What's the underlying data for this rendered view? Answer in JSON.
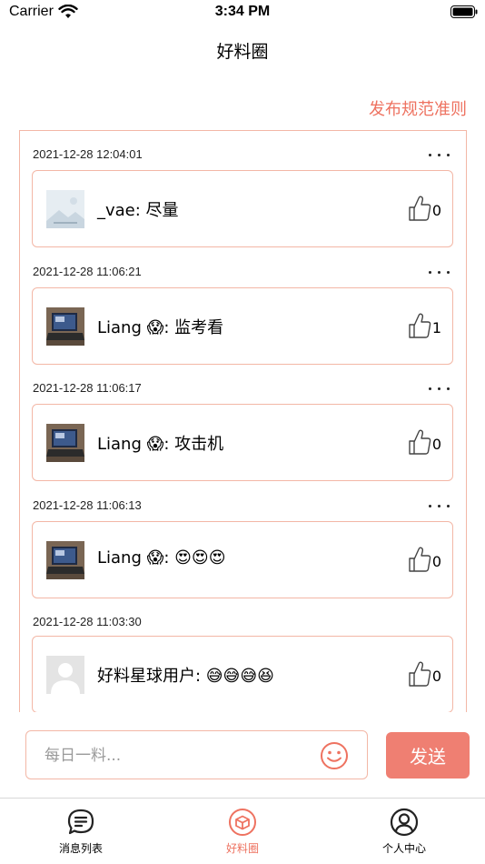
{
  "status_bar": {
    "carrier": "Carrier",
    "time": "3:34 PM"
  },
  "nav": {
    "title": "好料圈",
    "rules_link": "发布规范准则"
  },
  "colors": {
    "accent": "#ee7260",
    "border": "#f3b7a6",
    "send_button": "#ef7f72"
  },
  "posts": [
    {
      "time": "2021-12-28 12:04:01",
      "author": "_vae",
      "text": "_vae: 尽量",
      "likes": "0",
      "avatar": "placeholder-image",
      "has_more": true
    },
    {
      "time": "2021-12-28 11:06:21",
      "author": "Liang 😱",
      "text": "Liang 😱: 监考看",
      "likes": "1",
      "avatar": "laptop-photo",
      "has_more": true
    },
    {
      "time": "2021-12-28 11:06:17",
      "author": "Liang 😱",
      "text": "Liang 😱: 攻击机",
      "likes": "0",
      "avatar": "laptop-photo",
      "has_more": true
    },
    {
      "time": "2021-12-28 11:06:13",
      "author": "Liang 😱",
      "text": "Liang 😱: 😍😍😍",
      "likes": "0",
      "avatar": "laptop-photo",
      "has_more": true
    },
    {
      "time": "2021-12-28 11:03:30",
      "author": "好料星球用户",
      "text": "好料星球用户: 😅😅😅😆",
      "likes": "0",
      "avatar": "default-user",
      "has_more": false
    }
  ],
  "composer": {
    "placeholder": "每日一料...",
    "send_label": "发送",
    "emoji_icon": "smiley-icon"
  },
  "tabbar": {
    "items": [
      {
        "label": "消息列表",
        "icon": "message-list-icon",
        "active": false
      },
      {
        "label": "好料圈",
        "icon": "circle-box-icon",
        "active": true
      },
      {
        "label": "个人中心",
        "icon": "user-profile-icon",
        "active": false
      }
    ]
  }
}
